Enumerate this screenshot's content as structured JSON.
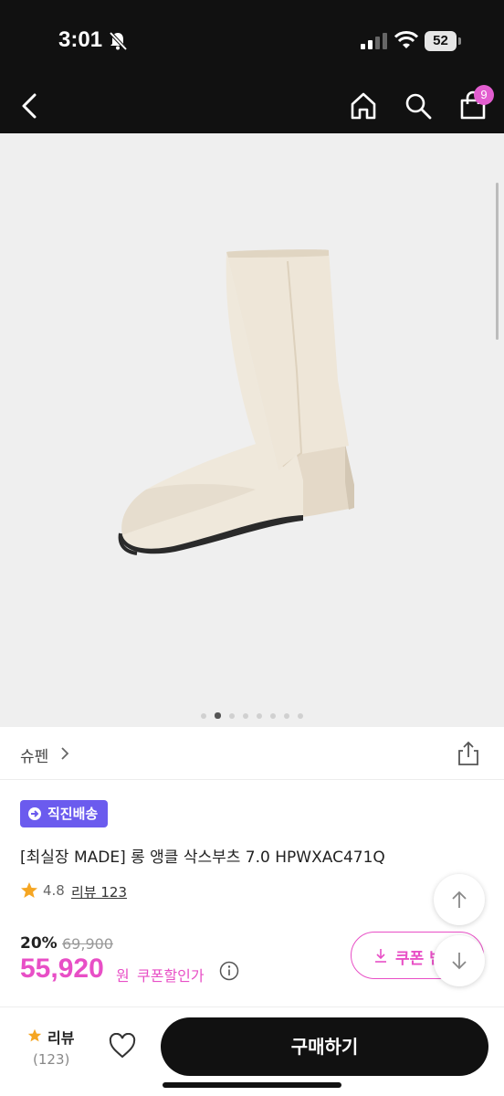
{
  "status_bar": {
    "time": "3:01",
    "battery": "52",
    "icons": [
      "bell-slash-icon",
      "signal-icon",
      "wifi-icon",
      "battery-icon"
    ]
  },
  "nav": {
    "icons": [
      "back-icon",
      "home-icon",
      "search-icon",
      "shopping-bag-icon"
    ],
    "cart_count": "9"
  },
  "gallery": {
    "image_count": 8,
    "active_index": 1
  },
  "brand": {
    "name": "슈펜"
  },
  "badge": {
    "label": "직진배송"
  },
  "product": {
    "title": "[최실장 MADE] 롱 앵클 삭스부츠 7.0 HPWXAC471Q"
  },
  "rating": {
    "value": "4.8",
    "review_link": "리뷰 123"
  },
  "price": {
    "discount_rate": "20%",
    "original": "69,900",
    "sale": "55,920",
    "unit": "원",
    "coupon_text": "쿠폰할인가"
  },
  "coupon_button": {
    "label": "쿠폰 받"
  },
  "bottom": {
    "review_label": "리뷰",
    "review_count": "(123)",
    "buy_label": "구매하기"
  },
  "colors": {
    "accent_pink": "#e84fc6",
    "badge_purple": "#6b5bee",
    "dark": "#111111"
  }
}
